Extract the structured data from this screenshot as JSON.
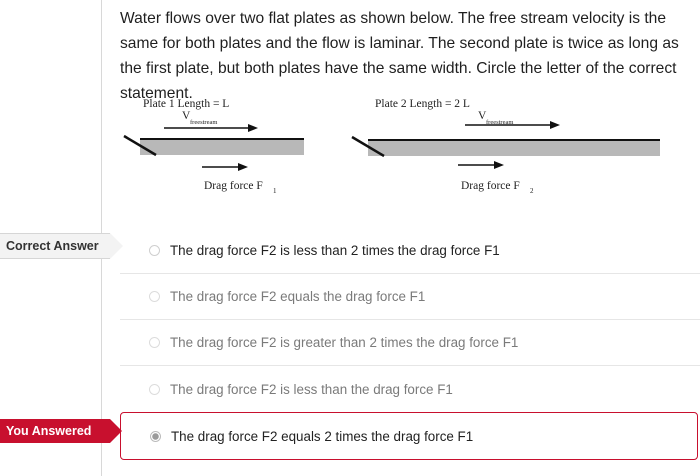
{
  "question": {
    "text": "Water flows over two flat plates as shown below. The free stream velocity is the same for both plates and the flow is laminar. The second plate is twice as long as the first plate, but both plates have the same width. Circle the letter of the correct statement."
  },
  "figure": {
    "plate1_title": "Plate 1  Length = L",
    "plate2_title": "Plate 2  Length = 2 L",
    "velocity_symbol": "V",
    "velocity_subscript": "freestream",
    "drag1_label": "Drag force F",
    "drag1_sub": "1",
    "drag2_label": "Drag force F",
    "drag2_sub": "2"
  },
  "tags": {
    "correct": "Correct Answer",
    "you_answered": "You Answered"
  },
  "answers": [
    {
      "label": "The drag force F2 is less than 2 times the drag force F1",
      "state": "correct"
    },
    {
      "label": "The drag force F2 equals the drag force F1",
      "state": "muted"
    },
    {
      "label": "The drag force F2 is greater than 2 times the drag force F1",
      "state": "muted"
    },
    {
      "label": "The drag force F2 is less than the drag force F1",
      "state": "muted"
    },
    {
      "label": "The drag force F2 equals 2 times the drag force F1",
      "state": "selected"
    }
  ]
}
